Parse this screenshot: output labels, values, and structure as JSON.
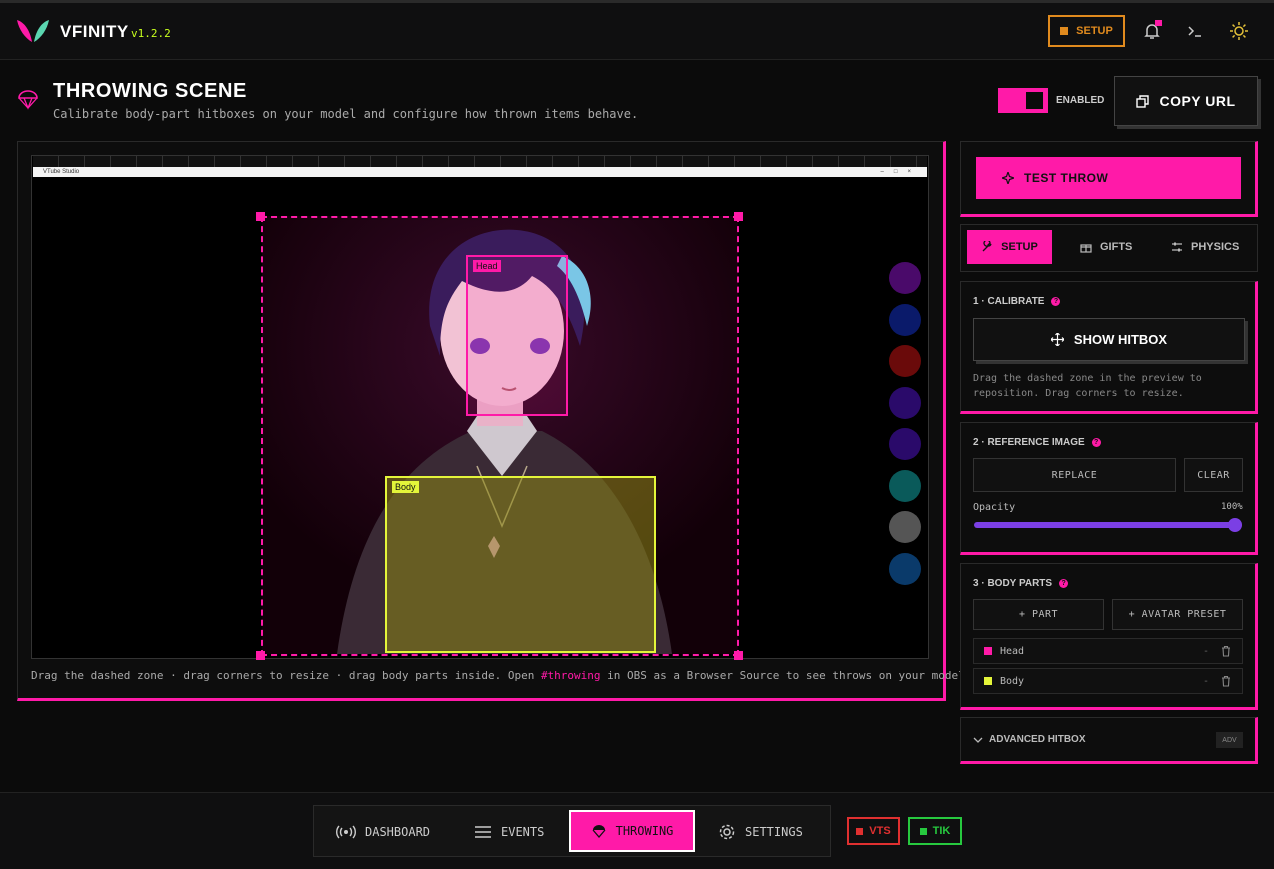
{
  "app": {
    "name": "VFINITY",
    "version": "v1.2.2"
  },
  "topbar": {
    "setup_label": "SETUP",
    "icons": [
      "bell-icon",
      "terminal-icon",
      "sun-icon"
    ]
  },
  "header": {
    "title": "THROWING SCENE",
    "subtitle": "Calibrate body-part hitboxes on your model and configure how thrown items behave.",
    "toggle_label": "ENABLED",
    "toggle_on": true,
    "copy_url_label": "COPY URL"
  },
  "preview": {
    "window_title": "VTube Studio",
    "head_tag": "Head",
    "body_tag": "Body",
    "swatch_colors": [
      "#4a0a6a",
      "#0a1a6a",
      "#6a0a0a",
      "#2a0a6a",
      "#2a0a6a",
      "#0a5a5a",
      "#555555",
      "#0a3a6a"
    ],
    "hint_pre": "Drag the dashed zone · drag corners to resize · drag body parts inside. Open ",
    "hint_highlight": "#throwing",
    "hint_post": " in OBS as a Browser Source to see throws on your model."
  },
  "sidebar": {
    "test_throw_label": "TEST THROW",
    "tabs": [
      {
        "label": "SETUP",
        "active": true
      },
      {
        "label": "GIFTS",
        "active": false
      },
      {
        "label": "PHYSICS",
        "active": false
      }
    ],
    "calibrate": {
      "title": "1 · CALIBRATE",
      "button": "SHOW HITBOX",
      "desc": "Drag the dashed zone in the preview to reposition. Drag corners to resize."
    },
    "reference": {
      "title": "2 · REFERENCE IMAGE",
      "replace": "REPLACE",
      "clear": "CLEAR",
      "opacity_label": "Opacity",
      "opacity_value": "100%"
    },
    "body_parts": {
      "title": "3 · BODY PARTS",
      "add_part": "+ PART",
      "avatar_preset": "+ AVATAR PRESET",
      "parts": [
        {
          "name": "Head",
          "color": "#ff1aa8",
          "value": "-"
        },
        {
          "name": "Body",
          "color": "#e4f53a",
          "value": "-"
        }
      ]
    },
    "advanced": {
      "label": "ADVANCED HITBOX",
      "badge": "ADV"
    }
  },
  "bottom_nav": {
    "items": [
      {
        "label": "DASHBOARD"
      },
      {
        "label": "EVENTS"
      },
      {
        "label": "THROWING",
        "active": true
      },
      {
        "label": "SETTINGS"
      }
    ],
    "status": [
      {
        "label": "VTS",
        "color": "#e03030"
      },
      {
        "label": "TIK",
        "color": "#27c93f"
      }
    ]
  },
  "colors": {
    "accent": "#ff1aa8",
    "lime": "#e4f53a",
    "orange": "#e08a1e",
    "purple": "#7b3fe4"
  }
}
